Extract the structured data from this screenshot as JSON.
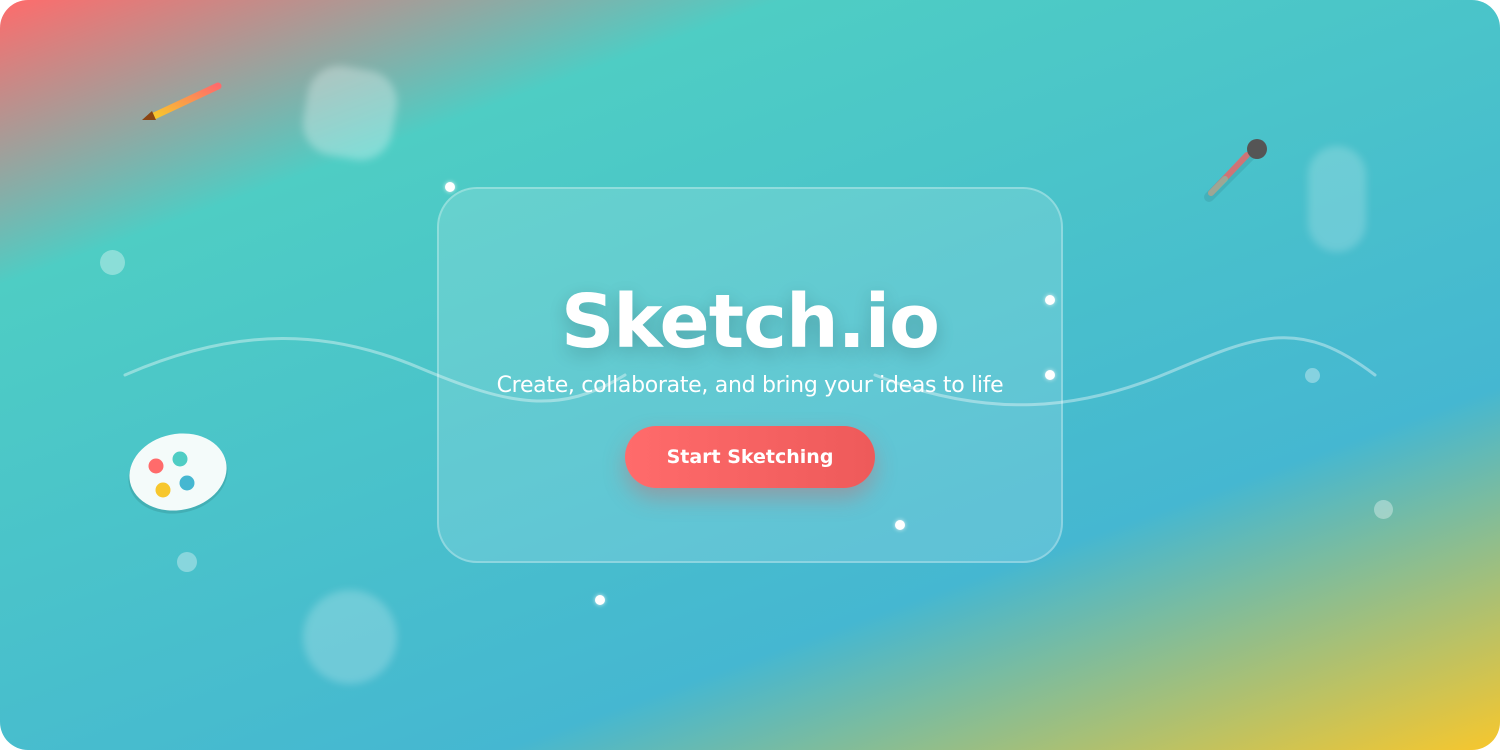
{
  "brand": {
    "title": "Sketch.io",
    "tagline": "Create, collaborate, and bring your ideas to life"
  },
  "cta": {
    "label": "Start Sketching"
  },
  "decorations": {
    "icons": [
      "pencil-icon",
      "paintbrush-icon",
      "palette-icon"
    ],
    "palette_colors": [
      "#ff6b6b",
      "#4ecdc4",
      "#f7c72d",
      "#45b7d1"
    ]
  },
  "colors": {
    "gradient_start": "#ff6b6b",
    "gradient_mid": "#4ecdc4",
    "gradient_blue": "#45b7d1",
    "gradient_end": "#f7c72d",
    "button": "#ff6b6b"
  }
}
